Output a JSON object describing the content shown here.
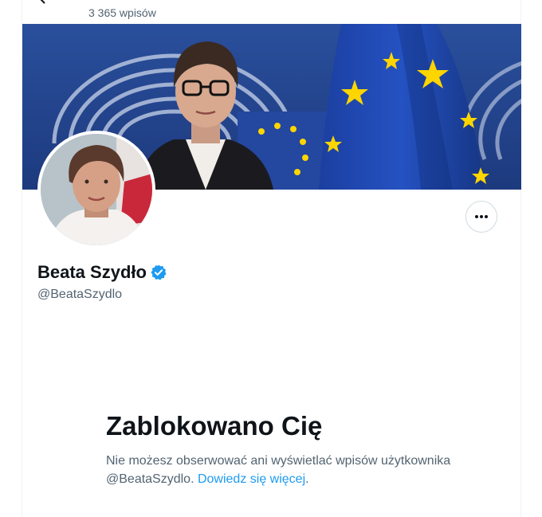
{
  "header": {
    "post_count": "3 365 wpisów"
  },
  "profile": {
    "display_name": "Beata Szydło",
    "handle": "@BeataSzydlo",
    "verified": true
  },
  "blocked": {
    "title": "Zablokowano Cię",
    "message": "Nie możesz obserwować ani wyświetlać wpisów użytkownika @BeataSzydlo.",
    "link_label": "Dowiedz się więcej",
    "trailing": "."
  },
  "icons": {
    "back": "arrow-left-icon",
    "more": "more-horizontal-icon",
    "verified": "verified-badge-icon"
  },
  "colors": {
    "accent": "#1d9bf0",
    "text_primary": "#0f1419",
    "text_secondary": "#536471",
    "eu_blue": "#1f4aa8",
    "eu_star": "#ffd500"
  }
}
